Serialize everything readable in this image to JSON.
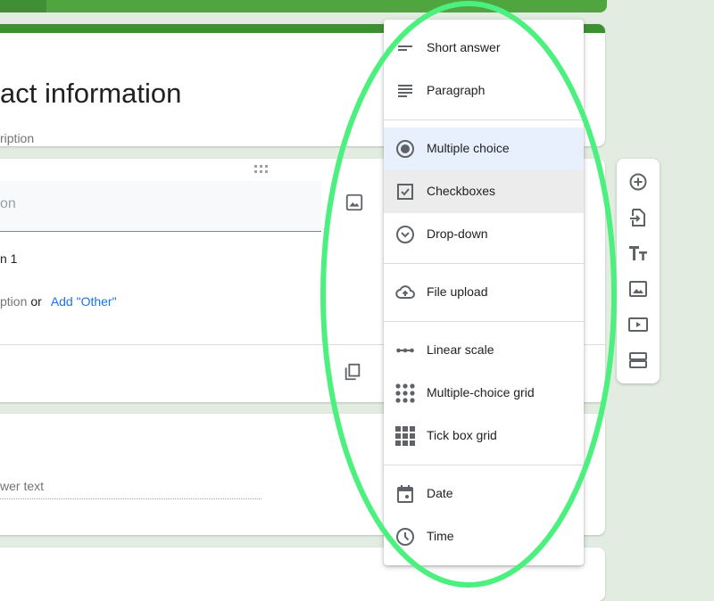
{
  "form": {
    "section_title": "act information",
    "section_description": "ription",
    "question": {
      "title_placeholder": "on",
      "option_1": "n 1",
      "add_option_placeholder": "ption",
      "or_label": "or",
      "add_other_link": "Add \"Other\""
    },
    "short_answer_question": {
      "answer_placeholder": "wer text"
    }
  },
  "question_type_menu": {
    "selected": "Multiple choice",
    "hovered": "Checkboxes",
    "items": [
      {
        "label": "Short answer",
        "icon": "short-text-icon"
      },
      {
        "label": "Paragraph",
        "icon": "paragraph-icon"
      },
      {
        "label": "Multiple choice",
        "icon": "radio-button-icon"
      },
      {
        "label": "Checkboxes",
        "icon": "checkbox-icon"
      },
      {
        "label": "Drop-down",
        "icon": "dropdown-circle-icon"
      },
      {
        "label": "File upload",
        "icon": "cloud-upload-icon"
      },
      {
        "label": "Linear scale",
        "icon": "linear-scale-icon"
      },
      {
        "label": "Multiple-choice grid",
        "icon": "dot-grid-icon"
      },
      {
        "label": "Tick box grid",
        "icon": "square-grid-icon"
      },
      {
        "label": "Date",
        "icon": "calendar-icon"
      },
      {
        "label": "Time",
        "icon": "clock-icon"
      }
    ]
  },
  "floating_toolbar": {
    "buttons": [
      {
        "name": "add-question",
        "icon": "add-circle-icon"
      },
      {
        "name": "import-questions",
        "icon": "import-icon"
      },
      {
        "name": "add-title-description",
        "icon": "title-text-icon"
      },
      {
        "name": "add-image",
        "icon": "image-icon"
      },
      {
        "name": "add-video",
        "icon": "video-icon"
      },
      {
        "name": "add-section",
        "icon": "section-icon"
      }
    ]
  },
  "colors": {
    "theme_green": "#3d8f31",
    "background": "#e2ece0",
    "selected_item": "#e8f0fe",
    "link_blue": "#1a73e8",
    "annotation_green": "#4cf07e"
  }
}
